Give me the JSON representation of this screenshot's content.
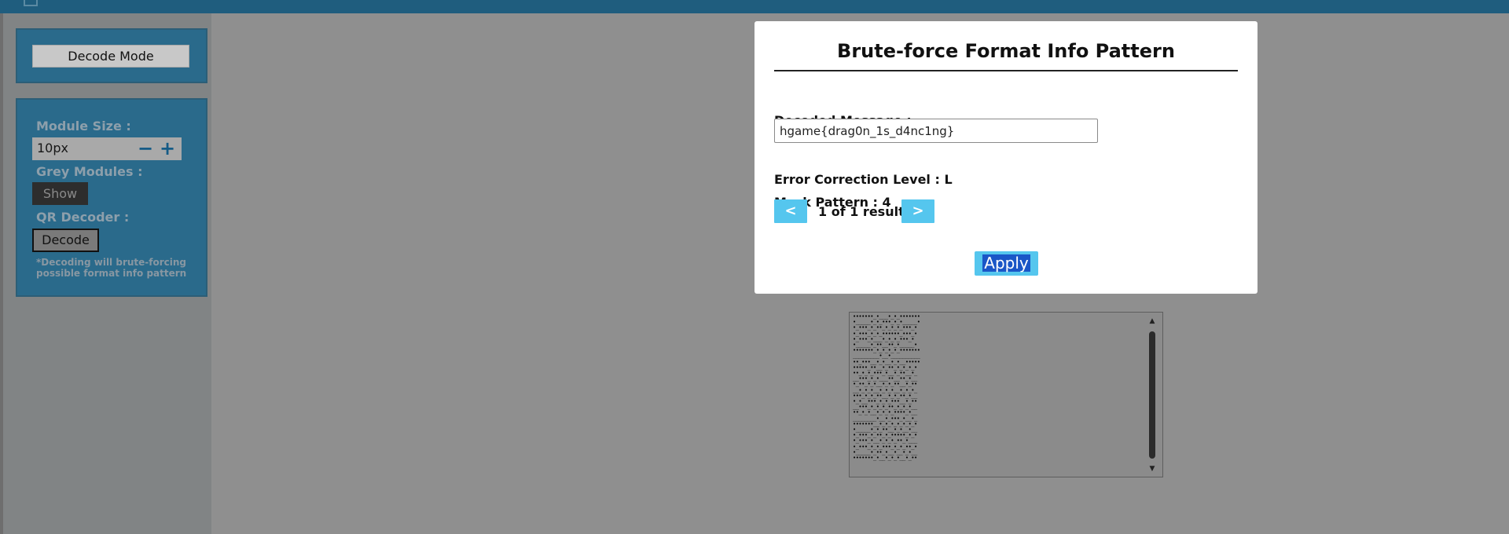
{
  "sidebar": {
    "mode_button_label": "Decode Mode",
    "module_size_label": "Module Size :",
    "module_size_value": "10px",
    "minus_symbol": "−",
    "plus_symbol": "+",
    "grey_modules_label": "Grey Modules :",
    "show_button_label": "Show",
    "qr_decoder_label": "QR Decoder :",
    "decode_button_label": "Decode",
    "note_text": "*Decoding will brute-forcing possible format info pattern"
  },
  "modal": {
    "title": "Brute-force Format Info Pattern",
    "decoded_message_label": "Decoded Message :",
    "decoded_message_value": "hgame{drag0n_1s_d4nc1ng}",
    "error_correction_text": "Error Correction Level : L",
    "mask_pattern_text": "Mask Pattern : 4",
    "prev_label": "<",
    "next_label": ">",
    "result_count": "1 of 1 result",
    "apply_label": "Apply"
  },
  "text_panel": {
    "lines": [
      "•••••••_•___•_•_•••••••",
      "•_____•_•_•••_•_•_____•",
      "•_•••_•_••_•_•_•_•••_•",
      "•_•••_•_•_••••••_•••_•",
      "•_•••_•___•_•_•_•••_•",
      "•_____•_••__••_•_____•",
      "•••••••_•_•_•_•_•••••••",
      "_________•__•__________",
      "••_•••__•_•__•_•__•••••",
      "•••••_••__•_••_•_•_•_•",
      "••_•_•_•••_•__•_••__•_",
      "__•••_•_•___••__••_•__",
      "•_••_•_•__•_•_••__•_••",
      "__•_•_•__•_•_•__•_•_•_",
      "•••_•_•_••__•_•_••_•__",
      "•_•__•••_•_•_•••__•_••",
      "__•••_•_•_•_••_•_•_•__",
      "••_•_•__•_•_•_••••_•__",
      "________•__•_•••_•__•_",
      "•••••••__•_•_•_•_•_•_•",
      "•_____•_•_••__•_•__•__",
      "•_•••_•_••_•_•••••_•_•",
      "•_•••_•__•_•_•_••_•___",
      "•_•••_•_•_•••_•_•_••_•",
      "•_____•_••_•__•__•_•__",
      "•••••••_•__•_•_•__•_••"
    ]
  },
  "icons": {
    "scroll_up": "▲",
    "scroll_down": "▼"
  },
  "colors": {
    "accent": "#55c6ee",
    "topbar": "#1f5d7e",
    "panel": "#2a6a8b"
  }
}
